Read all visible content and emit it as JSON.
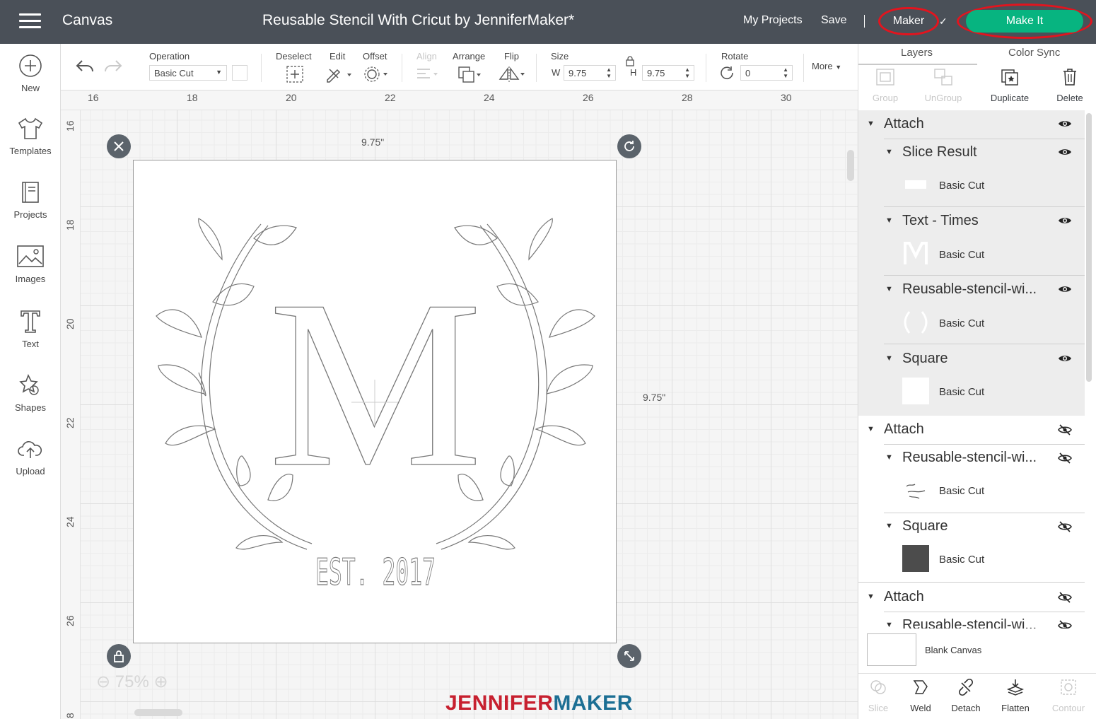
{
  "topbar": {
    "app_title": "Canvas",
    "doc_title": "Reusable Stencil With Cricut by JenniferMaker*",
    "my_projects": "My Projects",
    "save": "Save",
    "maker": "Maker",
    "make_it": "Make It",
    "accent": "#07b480"
  },
  "leftbar": [
    {
      "label": "New",
      "icon": "plus-circle-icon"
    },
    {
      "label": "Templates",
      "icon": "tshirt-icon"
    },
    {
      "label": "Projects",
      "icon": "book-icon"
    },
    {
      "label": "Images",
      "icon": "image-icon"
    },
    {
      "label": "Text",
      "icon": "text-t-icon"
    },
    {
      "label": "Shapes",
      "icon": "shapes-icon"
    },
    {
      "label": "Upload",
      "icon": "cloud-upload-icon"
    }
  ],
  "toolbar": {
    "operation_label": "Operation",
    "operation_value": "Basic Cut",
    "deselect": "Deselect",
    "edit": "Edit",
    "offset": "Offset",
    "align": "Align",
    "arrange": "Arrange",
    "flip": "Flip",
    "size": "Size",
    "w_label": "W",
    "w_value": "9.75",
    "h_label": "H",
    "h_value": "9.75",
    "rotate": "Rotate",
    "rotate_value": "0",
    "more": "More"
  },
  "ruler": {
    "top": [
      "16",
      "18",
      "20",
      "22",
      "24",
      "26",
      "28",
      "30"
    ],
    "left": [
      "16",
      "18",
      "20",
      "22",
      "24",
      "26",
      "8"
    ]
  },
  "canvas": {
    "width_label": "9.75\"",
    "height_label": "9.75\"",
    "monogram": "M",
    "est_text": "EST. 2017",
    "zoom": "75%",
    "brand_a": "JENNIFER",
    "brand_b": "MAKER"
  },
  "panel": {
    "tabs": [
      "Layers",
      "Color Sync"
    ],
    "actions": [
      {
        "label": "Group",
        "enabled": false
      },
      {
        "label": "UnGroup",
        "enabled": false
      },
      {
        "label": "Duplicate",
        "enabled": true
      },
      {
        "label": "Delete",
        "enabled": true
      }
    ],
    "layers": [
      {
        "name": "Attach",
        "visible": true
      },
      {
        "name": "Slice Result",
        "cut": "Basic Cut",
        "visible": true
      },
      {
        "name": "Text - Times",
        "cut": "Basic Cut",
        "visible": true
      },
      {
        "name": "Reusable-stencil-wi...",
        "cut": "Basic Cut",
        "visible": true
      },
      {
        "name": "Square",
        "cut": "Basic Cut",
        "visible": true
      },
      {
        "name": "Attach",
        "visible": false
      },
      {
        "name": "Reusable-stencil-wi...",
        "cut": "Basic Cut",
        "visible": false
      },
      {
        "name": "Square",
        "cut": "Basic Cut",
        "visible": false
      },
      {
        "name": "Attach",
        "visible": false
      },
      {
        "name": "Reusable-stencil-wi...",
        "visible": false
      }
    ],
    "blank_canvas": "Blank Canvas",
    "bottom_actions": [
      {
        "label": "Slice",
        "enabled": false
      },
      {
        "label": "Weld",
        "enabled": true
      },
      {
        "label": "Detach",
        "enabled": true
      },
      {
        "label": "Flatten",
        "enabled": true
      },
      {
        "label": "Contour",
        "enabled": false
      }
    ]
  }
}
